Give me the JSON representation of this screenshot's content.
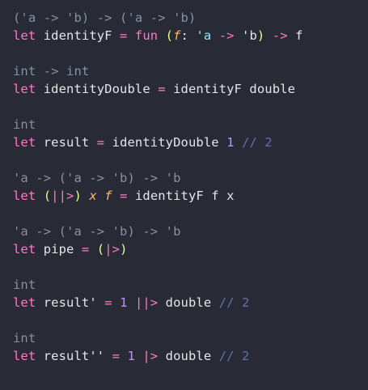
{
  "colors": {
    "background": "#282a36",
    "signature_hint": "#8b8fa3",
    "default_text": "#e6e6e6",
    "keyword": "#ff79c6",
    "parenthesis": "#f1fa8c",
    "parameter_italic": "#ffb86c",
    "type_variable": "#8be9fd",
    "number": "#bd93f9",
    "comment": "#6272a4"
  },
  "lines": [
    {
      "kind": "signature",
      "tokens": [
        {
          "text": "('a -> 'b) -> ('a -> 'b)",
          "role": "sig"
        }
      ]
    },
    {
      "kind": "code",
      "tokens": [
        {
          "text": "let",
          "role": "kw"
        },
        {
          "text": " identityF ",
          "role": "plain"
        },
        {
          "text": "=",
          "role": "op"
        },
        {
          "text": " ",
          "role": "plain"
        },
        {
          "text": "fun",
          "role": "kw"
        },
        {
          "text": " ",
          "role": "plain"
        },
        {
          "text": "(",
          "role": "paren"
        },
        {
          "text": "f",
          "role": "ital"
        },
        {
          "text": ": ",
          "role": "plain"
        },
        {
          "text": "'a",
          "role": "tv"
        },
        {
          "text": " ",
          "role": "plain"
        },
        {
          "text": "->",
          "role": "op"
        },
        {
          "text": " 'b",
          "role": "plain"
        },
        {
          "text": ")",
          "role": "paren"
        },
        {
          "text": " ",
          "role": "plain"
        },
        {
          "text": "->",
          "role": "op"
        },
        {
          "text": " f",
          "role": "plain"
        }
      ]
    },
    {
      "kind": "blank",
      "tokens": []
    },
    {
      "kind": "signature",
      "tokens": [
        {
          "text": "int -> int",
          "role": "sig"
        }
      ]
    },
    {
      "kind": "code",
      "tokens": [
        {
          "text": "let",
          "role": "kw"
        },
        {
          "text": " identityDouble ",
          "role": "plain"
        },
        {
          "text": "=",
          "role": "op"
        },
        {
          "text": " identityF double",
          "role": "plain"
        }
      ]
    },
    {
      "kind": "blank",
      "tokens": []
    },
    {
      "kind": "signature",
      "tokens": [
        {
          "text": "int",
          "role": "sig"
        }
      ]
    },
    {
      "kind": "code",
      "tokens": [
        {
          "text": "let",
          "role": "kw"
        },
        {
          "text": " result ",
          "role": "plain"
        },
        {
          "text": "=",
          "role": "op"
        },
        {
          "text": " identityDouble ",
          "role": "plain"
        },
        {
          "text": "1",
          "role": "num"
        },
        {
          "text": " // 2",
          "role": "comment"
        }
      ]
    },
    {
      "kind": "blank",
      "tokens": []
    },
    {
      "kind": "signature",
      "tokens": [
        {
          "text": "'a -> ('a -> 'b) -> 'b",
          "role": "sig"
        }
      ]
    },
    {
      "kind": "code",
      "tokens": [
        {
          "text": "let",
          "role": "kw"
        },
        {
          "text": " ",
          "role": "plain"
        },
        {
          "text": "(",
          "role": "paren"
        },
        {
          "text": "||>",
          "role": "op"
        },
        {
          "text": ")",
          "role": "paren"
        },
        {
          "text": " ",
          "role": "plain"
        },
        {
          "text": "x",
          "role": "ital"
        },
        {
          "text": " ",
          "role": "plain"
        },
        {
          "text": "f",
          "role": "ital"
        },
        {
          "text": " ",
          "role": "plain"
        },
        {
          "text": "=",
          "role": "op"
        },
        {
          "text": " identityF f x",
          "role": "plain"
        }
      ]
    },
    {
      "kind": "blank",
      "tokens": []
    },
    {
      "kind": "signature",
      "tokens": [
        {
          "text": "'a -> ('a -> 'b) -> 'b",
          "role": "sig"
        }
      ]
    },
    {
      "kind": "code",
      "tokens": [
        {
          "text": "let",
          "role": "kw"
        },
        {
          "text": " pipe ",
          "role": "plain"
        },
        {
          "text": "=",
          "role": "op"
        },
        {
          "text": " ",
          "role": "plain"
        },
        {
          "text": "(",
          "role": "paren"
        },
        {
          "text": "|>",
          "role": "op"
        },
        {
          "text": ")",
          "role": "paren"
        }
      ]
    },
    {
      "kind": "blank",
      "tokens": []
    },
    {
      "kind": "signature",
      "tokens": [
        {
          "text": "int",
          "role": "sig"
        }
      ]
    },
    {
      "kind": "code",
      "tokens": [
        {
          "text": "let",
          "role": "kw"
        },
        {
          "text": " result' ",
          "role": "plain"
        },
        {
          "text": "=",
          "role": "op"
        },
        {
          "text": " ",
          "role": "plain"
        },
        {
          "text": "1",
          "role": "num"
        },
        {
          "text": " ",
          "role": "plain"
        },
        {
          "text": "||>",
          "role": "op"
        },
        {
          "text": " double",
          "role": "plain"
        },
        {
          "text": " // 2",
          "role": "comment"
        }
      ]
    },
    {
      "kind": "blank",
      "tokens": []
    },
    {
      "kind": "signature",
      "tokens": [
        {
          "text": "int",
          "role": "sig"
        }
      ]
    },
    {
      "kind": "code",
      "tokens": [
        {
          "text": "let",
          "role": "kw"
        },
        {
          "text": " result'' ",
          "role": "plain"
        },
        {
          "text": "=",
          "role": "op"
        },
        {
          "text": " ",
          "role": "plain"
        },
        {
          "text": "1",
          "role": "num"
        },
        {
          "text": " ",
          "role": "plain"
        },
        {
          "text": "|>",
          "role": "op"
        },
        {
          "text": " double",
          "role": "plain"
        },
        {
          "text": " // 2",
          "role": "comment"
        }
      ]
    }
  ]
}
